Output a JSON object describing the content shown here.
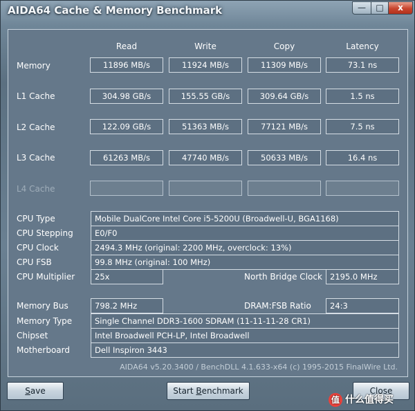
{
  "window": {
    "title": "AIDA64 Cache & Memory Benchmark",
    "controls": {
      "minimize": "—",
      "maximize": "□",
      "close": "x"
    }
  },
  "columns": [
    "Read",
    "Write",
    "Copy",
    "Latency"
  ],
  "rows": [
    {
      "label": "Memory",
      "values": [
        "11896 MB/s",
        "11924 MB/s",
        "11309 MB/s",
        "73.1 ns"
      ]
    },
    {
      "label": "L1 Cache",
      "values": [
        "304.98 GB/s",
        "155.55 GB/s",
        "309.64 GB/s",
        "1.5 ns"
      ]
    },
    {
      "label": "L2 Cache",
      "values": [
        "122.09 GB/s",
        "51363 MB/s",
        "77121 MB/s",
        "7.5 ns"
      ]
    },
    {
      "label": "L3 Cache",
      "values": [
        "61263 MB/s",
        "47740 MB/s",
        "50633 MB/s",
        "16.4 ns"
      ]
    },
    {
      "label": "L4 Cache",
      "values": [
        "",
        "",
        "",
        ""
      ]
    }
  ],
  "info": {
    "cpu_type": {
      "label": "CPU Type",
      "value": "Mobile DualCore Intel Core i5-5200U  (Broadwell-U, BGA1168)"
    },
    "cpu_stepping": {
      "label": "CPU Stepping",
      "value": "E0/F0"
    },
    "cpu_clock": {
      "label": "CPU Clock",
      "value": "2494.3 MHz  (original: 2200 MHz, overclock: 13%)"
    },
    "cpu_fsb": {
      "label": "CPU FSB",
      "value": "99.8 MHz  (original: 100 MHz)"
    },
    "cpu_multiplier": {
      "label": "CPU Multiplier",
      "value": "25x"
    },
    "nb_clock": {
      "label": "North Bridge Clock",
      "value": "2195.0 MHz"
    },
    "memory_bus": {
      "label": "Memory Bus",
      "value": "798.2 MHz"
    },
    "dram_fsb": {
      "label": "DRAM:FSB Ratio",
      "value": "24:3"
    },
    "memory_type": {
      "label": "Memory Type",
      "value": "Single Channel DDR3-1600 SDRAM  (11-11-11-28 CR1)"
    },
    "chipset": {
      "label": "Chipset",
      "value": "Intel Broadwell PCH-LP, Intel Broadwell"
    },
    "motherboard": {
      "label": "Motherboard",
      "value": "Dell Inspiron 3443"
    }
  },
  "footer": "AIDA64 v5.20.3400 / BenchDLL 4.1.633-x64  (c) 1995-2015 FinalWire Ltd.",
  "buttons": {
    "save": {
      "pre": "",
      "u": "S",
      "post": "ave"
    },
    "start": {
      "pre": "Start ",
      "u": "B",
      "post": "enchmark"
    },
    "close": "Close"
  },
  "watermark": {
    "badge": "值",
    "text": "什么值得买"
  }
}
